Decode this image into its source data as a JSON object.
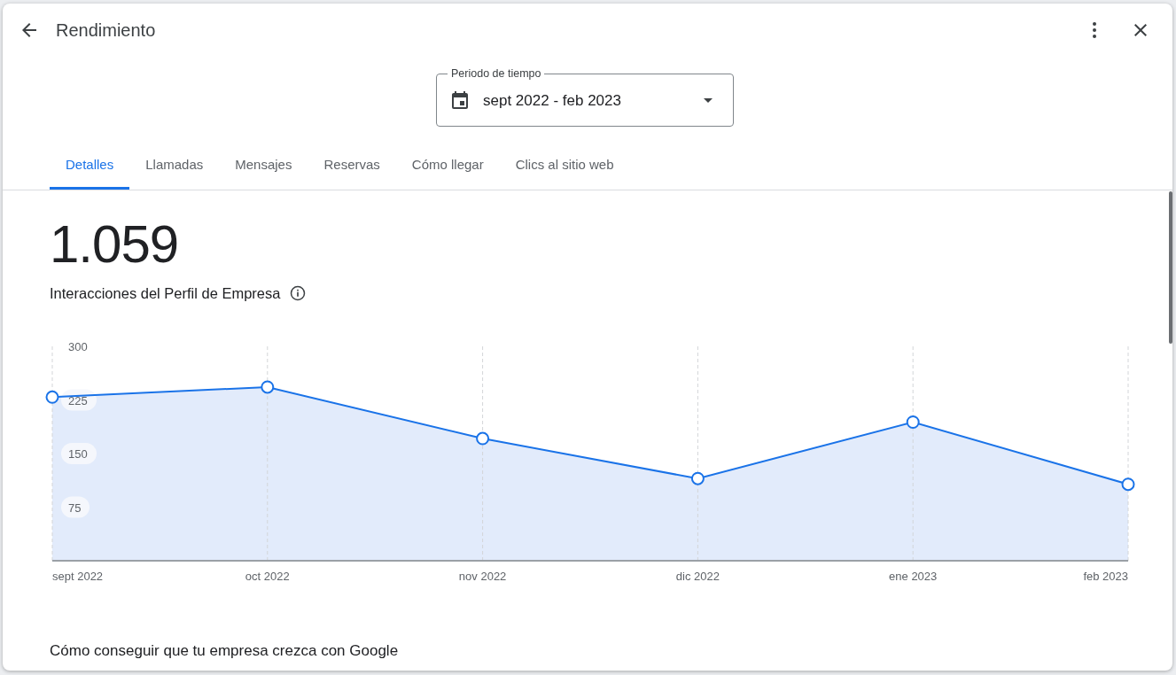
{
  "header": {
    "title": "Rendimiento"
  },
  "period": {
    "label": "Periodo de tiempo",
    "value": "sept 2022 - feb 2023"
  },
  "tabs": [
    {
      "label": "Detalles",
      "selected": true
    },
    {
      "label": "Llamadas",
      "selected": false
    },
    {
      "label": "Mensajes",
      "selected": false
    },
    {
      "label": "Reservas",
      "selected": false
    },
    {
      "label": "Cómo llegar",
      "selected": false
    },
    {
      "label": "Clics al sitio web",
      "selected": false
    }
  ],
  "summary": {
    "value": "1.059",
    "label": "Interacciones del Perfil de Empresa"
  },
  "chart_data": {
    "type": "area",
    "categories": [
      "sept 2022",
      "oct 2022",
      "nov 2022",
      "dic 2022",
      "ene 2023",
      "feb 2023"
    ],
    "series": [
      {
        "color": "#1a73e8",
        "values": [
          229,
          243,
          171,
          115,
          194,
          107
        ]
      }
    ],
    "grid": true,
    "ylim": [
      0,
      300
    ],
    "yticks": [
      75,
      150,
      225,
      300
    ]
  },
  "section_title": "Cómo conseguir que tu empresa crezca con Google"
}
